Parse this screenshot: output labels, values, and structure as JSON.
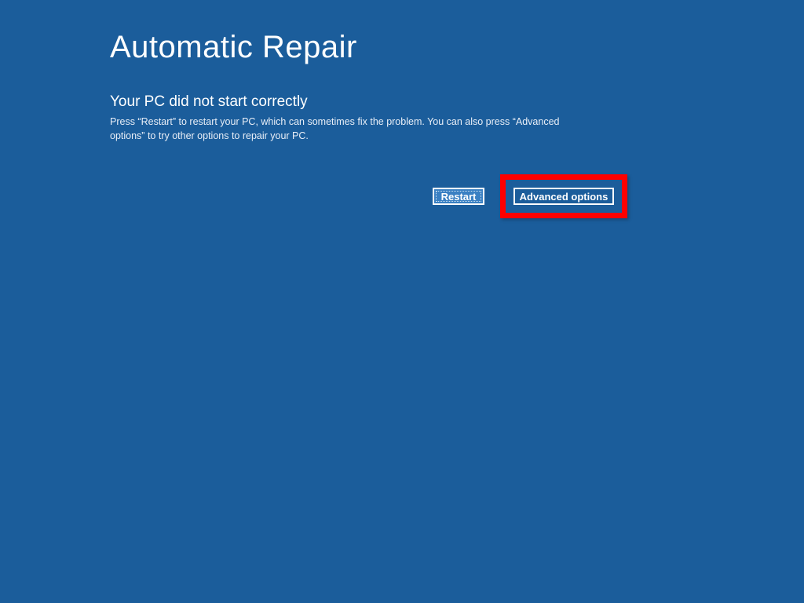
{
  "header": {
    "title": "Automatic Repair"
  },
  "main": {
    "subtitle": "Your PC did not start correctly",
    "description": "Press “Restart” to restart your PC, which can sometimes fix the problem. You can also press “Advanced options” to try other options to repair your PC."
  },
  "buttons": {
    "restart_label": "Restart",
    "advanced_label": "Advanced options"
  },
  "colors": {
    "background": "#1b5d9b",
    "highlight": "#ff0000",
    "button_active_bg": "#3a80c3"
  }
}
